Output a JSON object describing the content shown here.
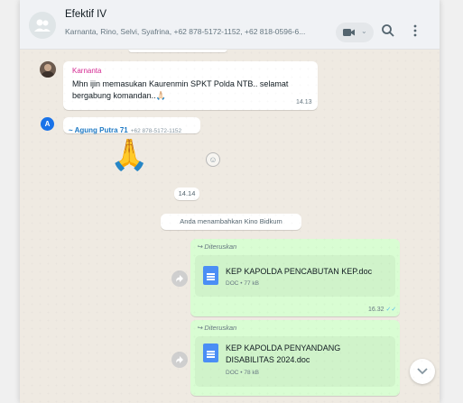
{
  "header": {
    "title": "Efektif IV",
    "subtitle": "Karnanta, Rino, Selvi, Syafrina, +62 878-5172-1152, +62 818-0596-6...",
    "icons": [
      "video-camera-icon",
      "search-icon",
      "menu-icon"
    ]
  },
  "messages": {
    "karnanta": {
      "sender": "Karnanta",
      "text": "Mhn ijin memasukan Kaurenmin SPKT Polda NTB.. selamat bergabung komandan..🙏🏻",
      "time": "14.13"
    },
    "agung": {
      "avatar_letter": "A",
      "sender": "~ Agung Putra 71",
      "phone": "+62 878-5172-1152",
      "emoji": "🙏"
    },
    "time_chip": "14.14",
    "system_notice": "Anda menambahkan Kino Bidkum",
    "doc1": {
      "forwarded_label": "Diteruskan",
      "name": "KEP KAPOLDA PENCABUTAN KEP.doc",
      "meta": "DOC • 77 kB",
      "time": "16.32"
    },
    "doc2": {
      "forwarded_label": "Diteruskan",
      "name": "KEP KAPOLDA PENYANDANG DISABILITAS 2024.doc",
      "meta": "DOC • 78 kB"
    }
  },
  "colors": {
    "header_bg": "#f0f2f5",
    "chat_bg": "#efeae2",
    "outgoing_bubble": "#d9fdd3",
    "sender_name": "#d42a92",
    "doc_icon": "#4b8ef5",
    "read_ticks": "#53bdeb"
  }
}
